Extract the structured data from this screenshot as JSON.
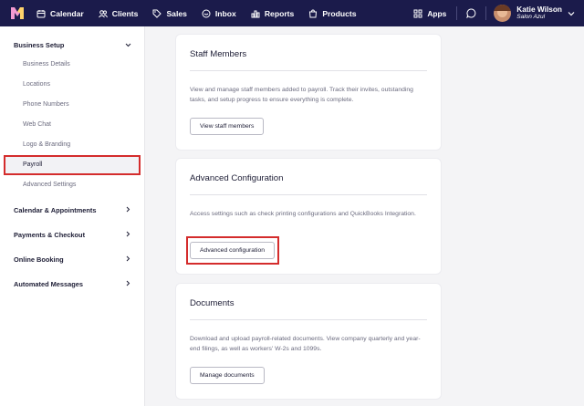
{
  "nav": {
    "items": [
      {
        "label": "Calendar",
        "icon": "calendar-icon"
      },
      {
        "label": "Clients",
        "icon": "clients-icon"
      },
      {
        "label": "Sales",
        "icon": "tag-icon"
      },
      {
        "label": "Inbox",
        "icon": "inbox-icon"
      },
      {
        "label": "Reports",
        "icon": "bar-chart-icon"
      },
      {
        "label": "Products",
        "icon": "bag-icon"
      }
    ],
    "apps_label": "Apps",
    "user_name": "Katie Wilson",
    "user_salon": "Salon Azul"
  },
  "sidebar": {
    "business_setup": "Business Setup",
    "sub_items": [
      "Business Details",
      "Locations",
      "Phone Numbers",
      "Web Chat",
      "Logo & Branding",
      "Payroll",
      "Advanced Settings"
    ],
    "sections": [
      "Calendar & Appointments",
      "Payments & Checkout",
      "Online Booking",
      "Automated Messages"
    ]
  },
  "cards": [
    {
      "title": "Staff Members",
      "description": "View and manage staff members added to payroll. Track their invites, outstanding tasks, and setup progress to ensure everything is complete.",
      "button": "View staff members"
    },
    {
      "title": "Advanced Configuration",
      "description": "Access settings such as check printing configurations and QuickBooks Integration.",
      "button": "Advanced configuration"
    },
    {
      "title": "Documents",
      "description": "Download and upload payroll-related documents. View company quarterly and year-end filings, as well as workers' W-2s and 1099s.",
      "button": "Manage documents"
    }
  ],
  "colors": {
    "topbar": "#1b1b4b",
    "highlight": "#d42c2c",
    "page_bg": "#f4f4f6"
  }
}
